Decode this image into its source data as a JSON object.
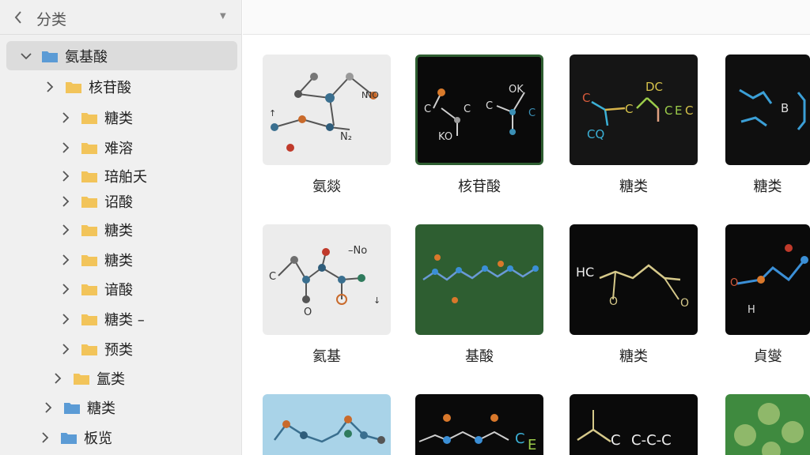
{
  "sidebar": {
    "header": {
      "title": "分类"
    },
    "items": [
      {
        "label": "氨基酸"
      },
      {
        "label": "核苷酸"
      },
      {
        "label": "糖类"
      },
      {
        "label": "难溶"
      },
      {
        "label": "琣舶夭"
      },
      {
        "label": "诏酸"
      },
      {
        "label": "糖类"
      },
      {
        "label": "糖类"
      },
      {
        "label": "谙酸"
      },
      {
        "label": "糖类 –"
      },
      {
        "label": "预类"
      },
      {
        "label": "氲类"
      },
      {
        "label": "糖类"
      },
      {
        "label": "板览"
      }
    ]
  },
  "grid": {
    "items": [
      {
        "caption": "氨燚",
        "tile_text": [
          "N",
          "NO",
          "N₂",
          "↑"
        ]
      },
      {
        "caption": "核苷酸",
        "tile_text": [
          "OK",
          "KO",
          "C",
          "C",
          "C",
          "C"
        ]
      },
      {
        "caption": "糖类",
        "tile_text": [
          "DC",
          "C",
          "C",
          "CQ",
          "C",
          "E",
          "C"
        ]
      },
      {
        "caption": "糖类",
        "tile_text": [
          "B"
        ]
      },
      {
        "caption": "氦基",
        "tile_text": [
          "–No",
          "C",
          "O",
          "↓"
        ]
      },
      {
        "caption": "基酸",
        "tile_text": []
      },
      {
        "caption": "糖类",
        "tile_text": [
          "HC",
          "O",
          "O"
        ]
      },
      {
        "caption": "貞燮",
        "tile_text": [
          "O",
          "H"
        ]
      },
      {
        "caption": "",
        "tile_text": []
      },
      {
        "caption": "",
        "tile_text": [
          "C",
          "E"
        ]
      },
      {
        "caption": "",
        "tile_text": [
          "C",
          "C-C-C"
        ]
      },
      {
        "caption": "",
        "tile_text": []
      }
    ]
  },
  "colors": {
    "sidebar_bg": "#f0f0f0",
    "selected_row": "#dcdcdc",
    "folder_blue": "#5b9bd5",
    "folder_yellow": "#f2c45a",
    "tile_green": "#2e5e31"
  }
}
